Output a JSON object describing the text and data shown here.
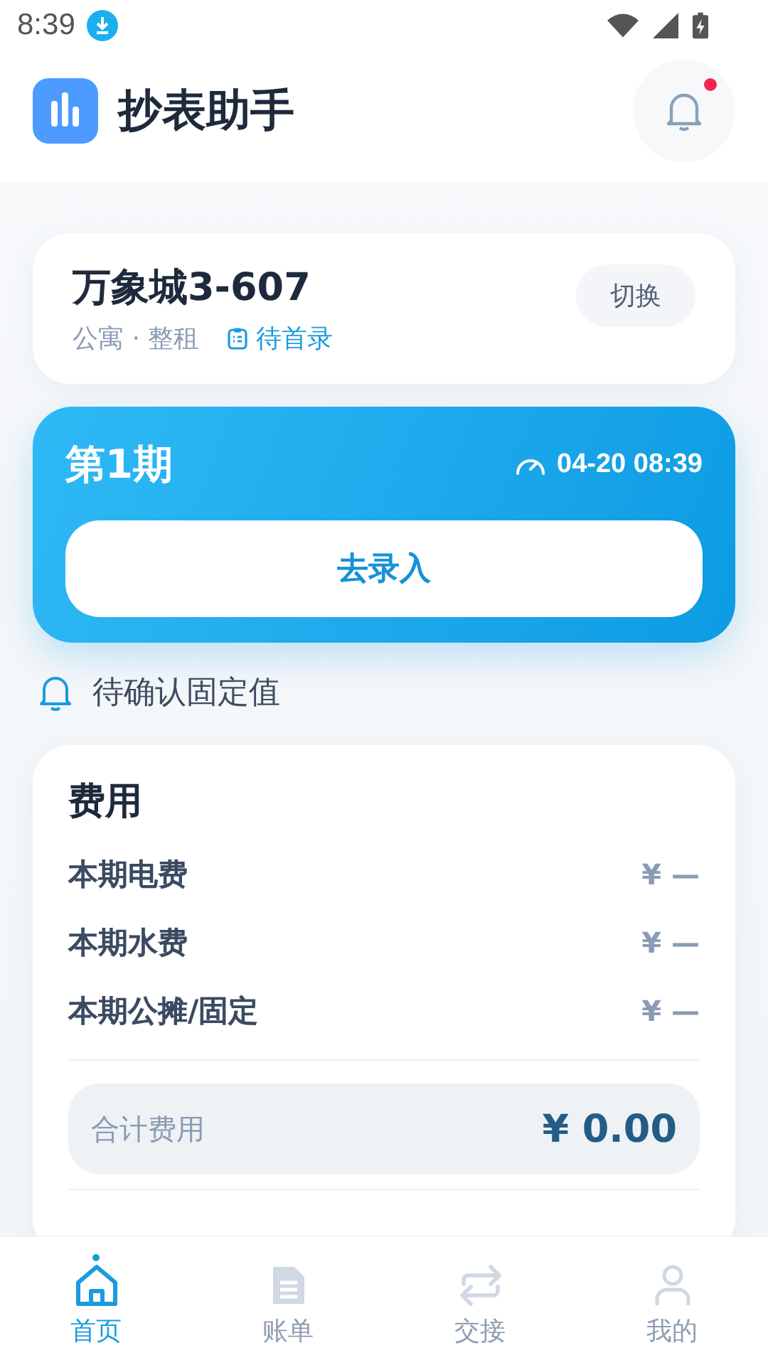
{
  "status_bar": {
    "time": "8:39"
  },
  "header": {
    "title": "抄表助手",
    "has_unread": true
  },
  "property": {
    "name": "万象城3-607",
    "meta": "公寓 · 整租",
    "status": "待首录",
    "switch_label": "切换"
  },
  "period": {
    "title": "第1期",
    "time": "04-20 08:39",
    "action": "去录入"
  },
  "notice": {
    "text": "待确认固定值"
  },
  "fees": {
    "title": "费用",
    "rows": [
      {
        "label": "本期电费",
        "value": "¥ —"
      },
      {
        "label": "本期水费",
        "value": "¥ —"
      },
      {
        "label": "本期公摊/固定",
        "value": "¥ —"
      }
    ],
    "total_label": "合计费用",
    "total_value": "¥ 0.00"
  },
  "tabs": [
    {
      "label": "首页",
      "kind": "home",
      "selected": true
    },
    {
      "label": "账单",
      "kind": "bill",
      "selected": false
    },
    {
      "label": "交接",
      "kind": "swap",
      "selected": false
    },
    {
      "label": "我的",
      "kind": "user",
      "selected": false
    }
  ]
}
